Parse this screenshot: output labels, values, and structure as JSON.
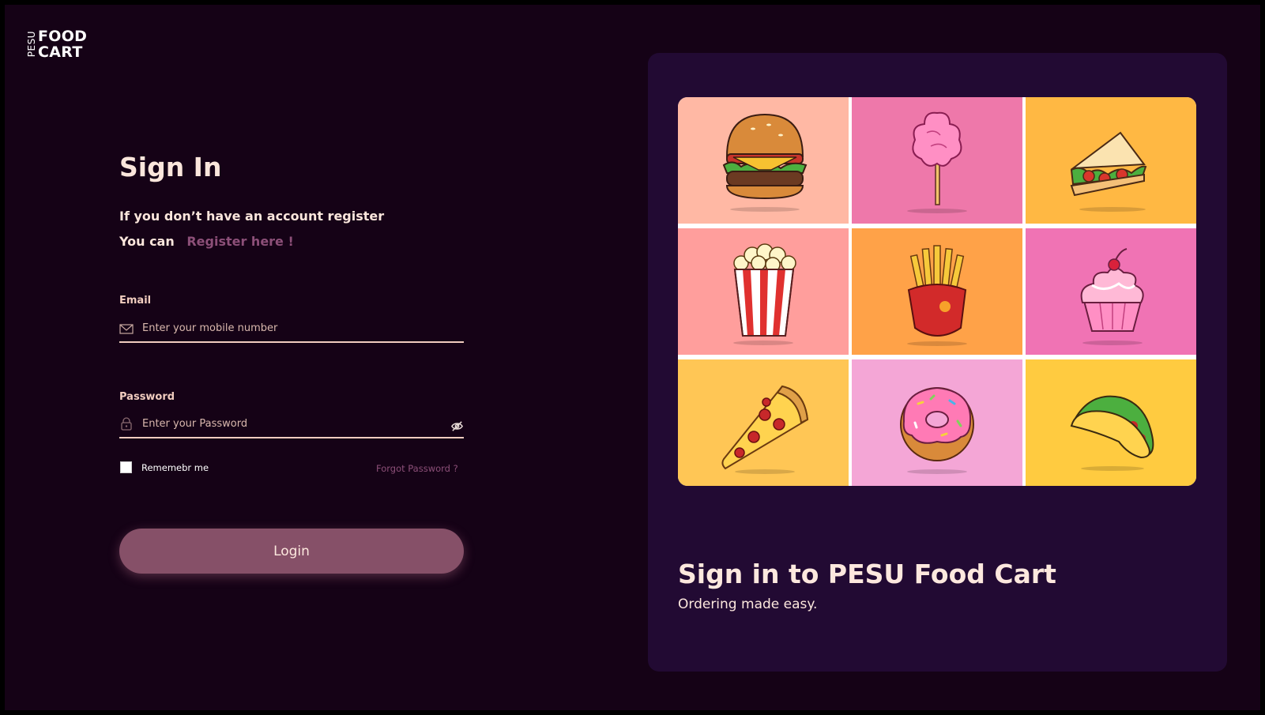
{
  "logo": {
    "vertical_text": "PESU",
    "line1": "FOOD",
    "line2": "CART"
  },
  "signin": {
    "title": "Sign In",
    "subtitle_line1": "If you don’t have an account register",
    "subtitle_prefix": "You can",
    "register_link": "Register here !"
  },
  "email": {
    "label": "Email",
    "placeholder": "Enter your mobile number",
    "value": "",
    "icon": "mail-icon"
  },
  "password": {
    "label": "Password",
    "placeholder": "Enter your Password",
    "value": "",
    "icon": "lock-icon",
    "toggle_icon": "eye-off-icon"
  },
  "remember": {
    "label": "Rememebr me",
    "checked": false
  },
  "forgot": "Forgot Password ?",
  "login_label": "Login",
  "hero": {
    "title": "Sign in to PESU Food Cart",
    "subtitle": "Ordering made easy.",
    "tiles": [
      {
        "item": "burger",
        "bg": "#ffb8a4"
      },
      {
        "item": "cotton-candy",
        "bg": "#ee78aa"
      },
      {
        "item": "sandwich",
        "bg": "#ffb843"
      },
      {
        "item": "popcorn",
        "bg": "#ff9e9c"
      },
      {
        "item": "fries",
        "bg": "#ffa248"
      },
      {
        "item": "cupcake",
        "bg": "#f073b4"
      },
      {
        "item": "pizza",
        "bg": "#ffc655"
      },
      {
        "item": "donut",
        "bg": "#f4a6d6"
      },
      {
        "item": "taco",
        "bg": "#ffcb40"
      }
    ]
  },
  "colors": {
    "background": "#150216",
    "panel": "#220a33",
    "accent": "#865068",
    "text": "#fbe6dc",
    "link": "#8c4f78"
  }
}
